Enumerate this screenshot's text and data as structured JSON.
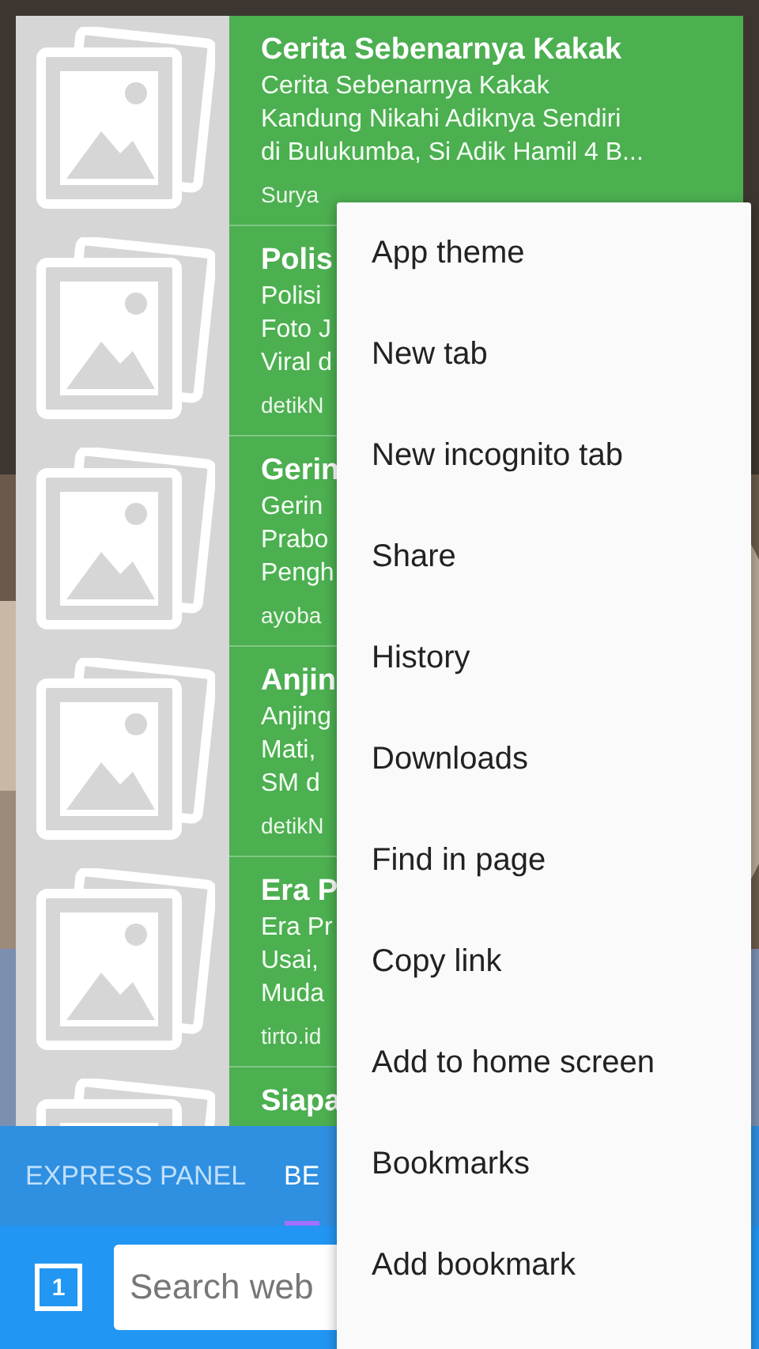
{
  "news": [
    {
      "title": "Cerita Sebenarnya Kakak",
      "lines": [
        "Cerita Sebenarnya Kakak",
        "Kandung Nikahi Adiknya Sendiri",
        "di Bulukumba, Si Adik Hamil 4 B..."
      ],
      "source": "Surya"
    },
    {
      "title": "Polis",
      "lines": [
        "Polisi",
        "Foto J",
        "Viral d"
      ],
      "source": "detikN"
    },
    {
      "title": "Gerin",
      "lines": [
        "Gerin",
        "Prabo",
        "Pengh"
      ],
      "source": "ayoba"
    },
    {
      "title": "Anjin",
      "lines": [
        "Anjing",
        "Mati,",
        "SM  d"
      ],
      "source": "detikN"
    },
    {
      "title": "Era P",
      "lines": [
        "Era Pr",
        "Usai,",
        "Muda"
      ],
      "source": "tirto.id"
    },
    {
      "title": "Siapa"
    }
  ],
  "tabs": [
    {
      "label": "EXPRESS PANEL",
      "selected": false
    },
    {
      "label": "BE",
      "selected": true
    }
  ],
  "tab_count": "1",
  "search": {
    "placeholder": "Search web"
  },
  "menu": [
    "App theme",
    "New tab",
    "New incognito tab",
    "Share",
    "History",
    "Downloads",
    "Find in page",
    "Copy link",
    "Add to home screen",
    "Bookmarks",
    "Add bookmark"
  ]
}
